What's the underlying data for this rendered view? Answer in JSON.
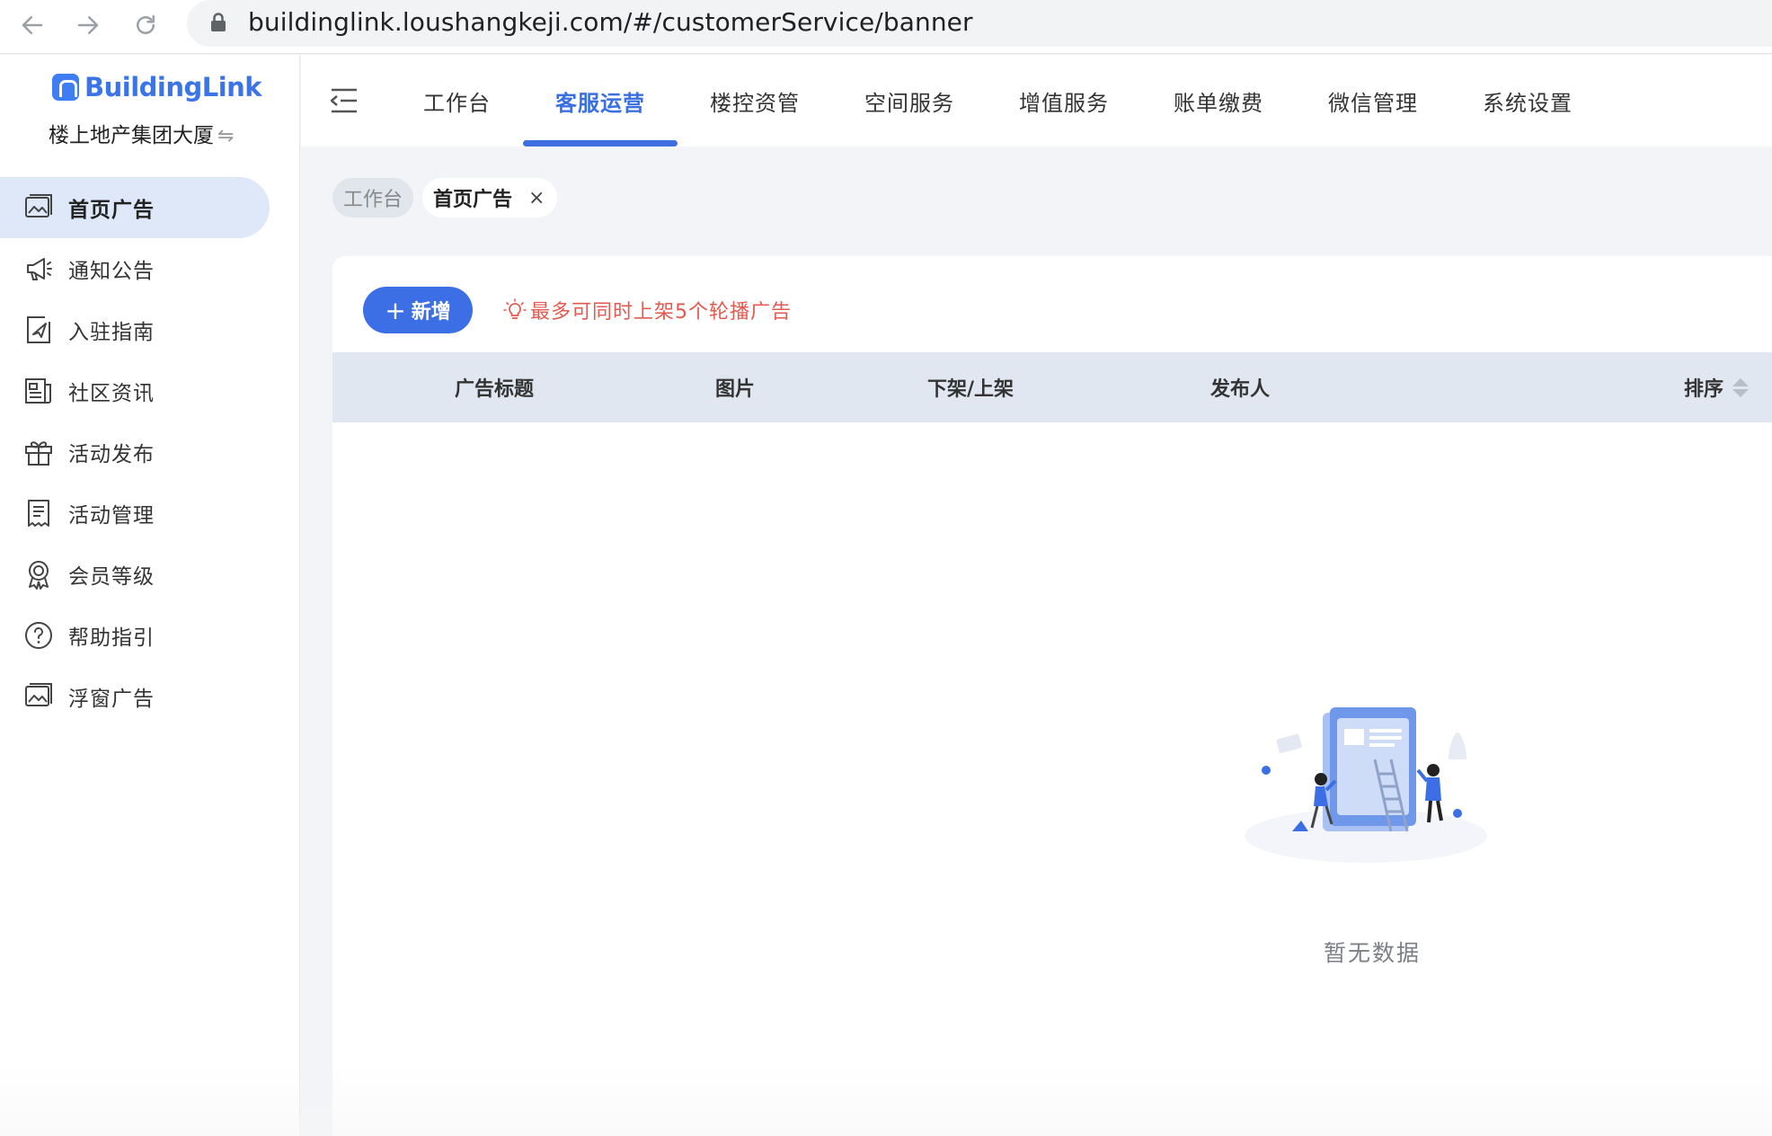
{
  "browser": {
    "url": "buildinglink.loushangkeji.com/#/customerService/banner"
  },
  "brand": {
    "logo_text": "BuildingLink",
    "building_name": "楼上地产集团大厦",
    "switch_symbol": "⇋",
    "accent_color": "#3c6ee5"
  },
  "sidebar": {
    "items": [
      {
        "label": "首页广告",
        "icon": "image-gallery-icon",
        "active": true
      },
      {
        "label": "通知公告",
        "icon": "megaphone-icon"
      },
      {
        "label": "入驻指南",
        "icon": "send-document-icon"
      },
      {
        "label": "社区资讯",
        "icon": "newspaper-icon"
      },
      {
        "label": "活动发布",
        "icon": "gift-icon"
      },
      {
        "label": "活动管理",
        "icon": "receipt-icon"
      },
      {
        "label": "会员等级",
        "icon": "medal-icon"
      },
      {
        "label": "帮助指引",
        "icon": "help-circle-icon"
      },
      {
        "label": "浮窗广告",
        "icon": "image-gallery-icon"
      }
    ]
  },
  "topnav": {
    "tabs": [
      {
        "label": "工作台"
      },
      {
        "label": "客服运营",
        "active": true
      },
      {
        "label": "楼控资管"
      },
      {
        "label": "空间服务"
      },
      {
        "label": "增值服务"
      },
      {
        "label": "账单缴费"
      },
      {
        "label": "微信管理"
      },
      {
        "label": "系统设置"
      }
    ]
  },
  "breadcrumbs": {
    "home": "工作台",
    "current": "首页广告",
    "close_symbol": "×"
  },
  "toolbar": {
    "add_label": "新增",
    "add_symbol": "+",
    "tip": "最多可同时上架5个轮播广告",
    "tip_color": "#e35a50"
  },
  "table": {
    "columns": [
      "广告标题",
      "图片",
      "下架/上架",
      "发布人",
      "排序"
    ],
    "rows": []
  },
  "empty_state": {
    "text": "暂无数据"
  }
}
